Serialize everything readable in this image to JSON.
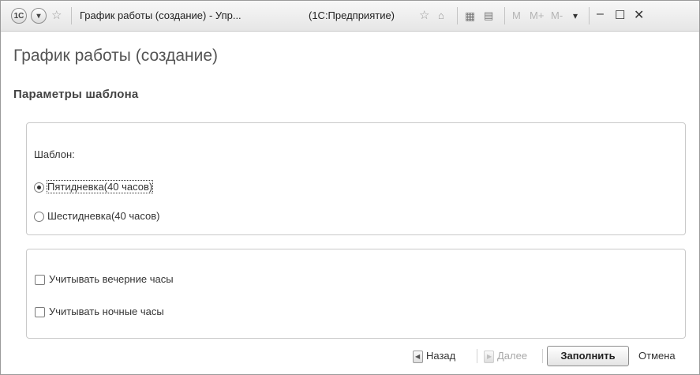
{
  "window": {
    "title": "График работы (создание) - Упр...",
    "app_name": "(1С:Предприятие)",
    "app_logo": "1С",
    "toolbar_text": {
      "m": "M",
      "m_plus": "M+",
      "m_minus": "M-"
    }
  },
  "page": {
    "title": "График работы (создание)",
    "section_title": "Параметры шаблона"
  },
  "template_group": {
    "label": "Шаблон:",
    "options": [
      {
        "label": "Пятидневка(40 часов)",
        "selected": true
      },
      {
        "label": "Шестидневка(40 часов)",
        "selected": false
      }
    ]
  },
  "options_group": {
    "checkboxes": [
      {
        "label": "Учитывать вечерние часы",
        "checked": false
      },
      {
        "label": "Учитывать ночные часы",
        "checked": false
      }
    ]
  },
  "footer": {
    "back_label": "Назад",
    "next_label": "Далее",
    "fill_label": "Заполнить",
    "cancel_label": "Отмена"
  }
}
